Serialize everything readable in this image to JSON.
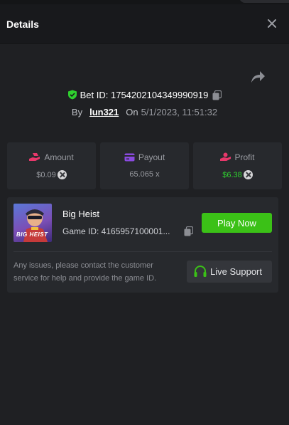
{
  "header": {
    "title": "Details",
    "close_icon": "close-icon"
  },
  "bet": {
    "id_label": "Bet ID: ",
    "id_value": "1754202104349990919",
    "by_label": "By",
    "username": "lun321",
    "on_label": "On",
    "datetime": "5/1/2023, 11:51:32"
  },
  "stats": {
    "amount": {
      "label": "Amount",
      "value": "$0.09",
      "icon": "wallet-hand-icon",
      "color": "#e8386b"
    },
    "payout": {
      "label": "Payout",
      "value": "65.065 x",
      "icon": "card-icon",
      "color": "#8a4ae0"
    },
    "profit": {
      "label": "Profit",
      "value": "$6.38",
      "icon": "profit-hand-icon",
      "color": "#e8386b",
      "value_color": "#2fd02f"
    }
  },
  "game": {
    "name": "Big Heist",
    "thumb_text": "BIG HEIST",
    "id_text": "Game ID: 4165957100001...",
    "play_label": "Play Now",
    "notice": "Any issues, please contact the customer service for help and provide the game ID.",
    "support_label": "Live Support"
  },
  "colors": {
    "accent_green": "#3bc117",
    "background": "#1f2023",
    "card": "#27292d"
  }
}
